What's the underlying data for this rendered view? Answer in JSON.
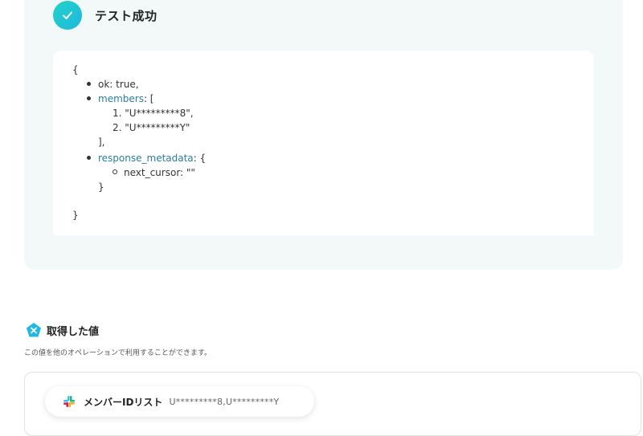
{
  "success": {
    "title": "テスト成功",
    "icon": "check-icon",
    "accent_color": "#1fc8d4"
  },
  "json_output": {
    "open_brace": "{",
    "ok_line": "ok: true,",
    "members_key": "members",
    "members_open": ": [",
    "members_items": [
      "1. \"U*********8\",",
      "2. \"U*********Y\""
    ],
    "members_close": "],",
    "metadata_key": "response_metadata",
    "metadata_open": ": {",
    "next_cursor_line": "next_cursor: \"\"",
    "metadata_close": "}",
    "close_brace": "}"
  },
  "acquired": {
    "title": "取得した値",
    "description": "この値を他のオペレーションで利用することができます。",
    "icon": "x-pentagon-icon"
  },
  "values": [
    {
      "icon": "slack-icon",
      "label": "メンバーIDリスト",
      "value": "U*********8,U*********Y"
    }
  ]
}
